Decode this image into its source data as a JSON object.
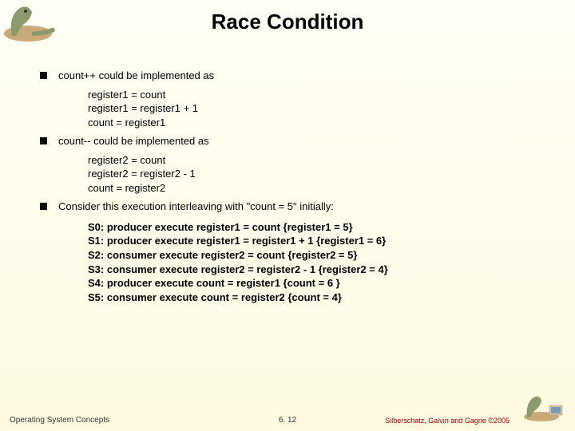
{
  "title": "Race Condition",
  "bullets": {
    "b1": "count++ could be implemented as",
    "b2": "count-- could be implemented as",
    "b3": "Consider this execution interleaving with \"count = 5\" initially:"
  },
  "code1": {
    "l1": "register1 = count",
    "l2": "register1 = register1 + 1",
    "l3": "count = register1"
  },
  "code2": {
    "l1": "register2 = count",
    "l2": "register2 = register2 - 1",
    "l3": "count = register2"
  },
  "steps": {
    "s0": "S0: producer execute register1 = count   {register1 = 5}",
    "s1": "S1: producer execute register1 = register1 + 1   {register1 = 6}",
    "s2": "S2: consumer execute register2 = count   {register2 = 5}",
    "s3": "S3: consumer execute register2 = register2 - 1   {register2 = 4}",
    "s4": "S4: producer execute count = register1   {count = 6 }",
    "s5": "S5: consumer execute count = register2   {count = 4}"
  },
  "footer": {
    "left": "Operating System Concepts",
    "mid": "6. 12",
    "right": "Silberschatz, Galvin and Gagne ©2005"
  }
}
